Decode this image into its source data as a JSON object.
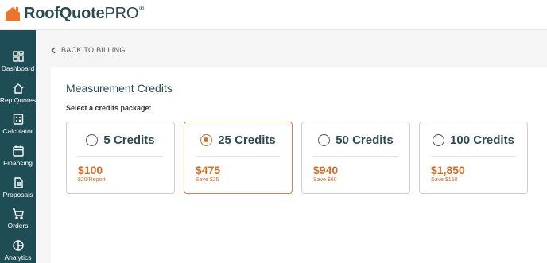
{
  "brand": {
    "name_bold": "RoofQuote",
    "name_light": "PRO",
    "reg": "®"
  },
  "colors": {
    "accent": "#d06f2c",
    "sidebar": "#1f4d55",
    "text": "#2b4a52"
  },
  "sidebar": {
    "items": [
      {
        "label": "Dashboard",
        "icon": "dashboard-icon"
      },
      {
        "label": "Rep Quotes",
        "icon": "house-icon"
      },
      {
        "label": "Calculator",
        "icon": "calculator-icon"
      },
      {
        "label": "Financing",
        "icon": "calendar-icon"
      },
      {
        "label": "Proposals",
        "icon": "document-icon"
      },
      {
        "label": "Orders",
        "icon": "cart-icon"
      },
      {
        "label": "Analytics",
        "icon": "pie-chart-icon"
      }
    ]
  },
  "back_link": {
    "label": "BACK TO BILLING"
  },
  "card": {
    "title": "Measurement Credits",
    "subtitle": "Select a credits package:",
    "packages": [
      {
        "label": "5 Credits",
        "price": "$100",
        "note": "$20/Report",
        "selected": false
      },
      {
        "label": "25 Credits",
        "price": "$475",
        "note": "Save $25",
        "selected": true
      },
      {
        "label": "50 Credits",
        "price": "$940",
        "note": "Save $60",
        "selected": false
      },
      {
        "label": "100 Credits",
        "price": "$1,850",
        "note": "Save $150",
        "selected": false
      }
    ]
  }
}
